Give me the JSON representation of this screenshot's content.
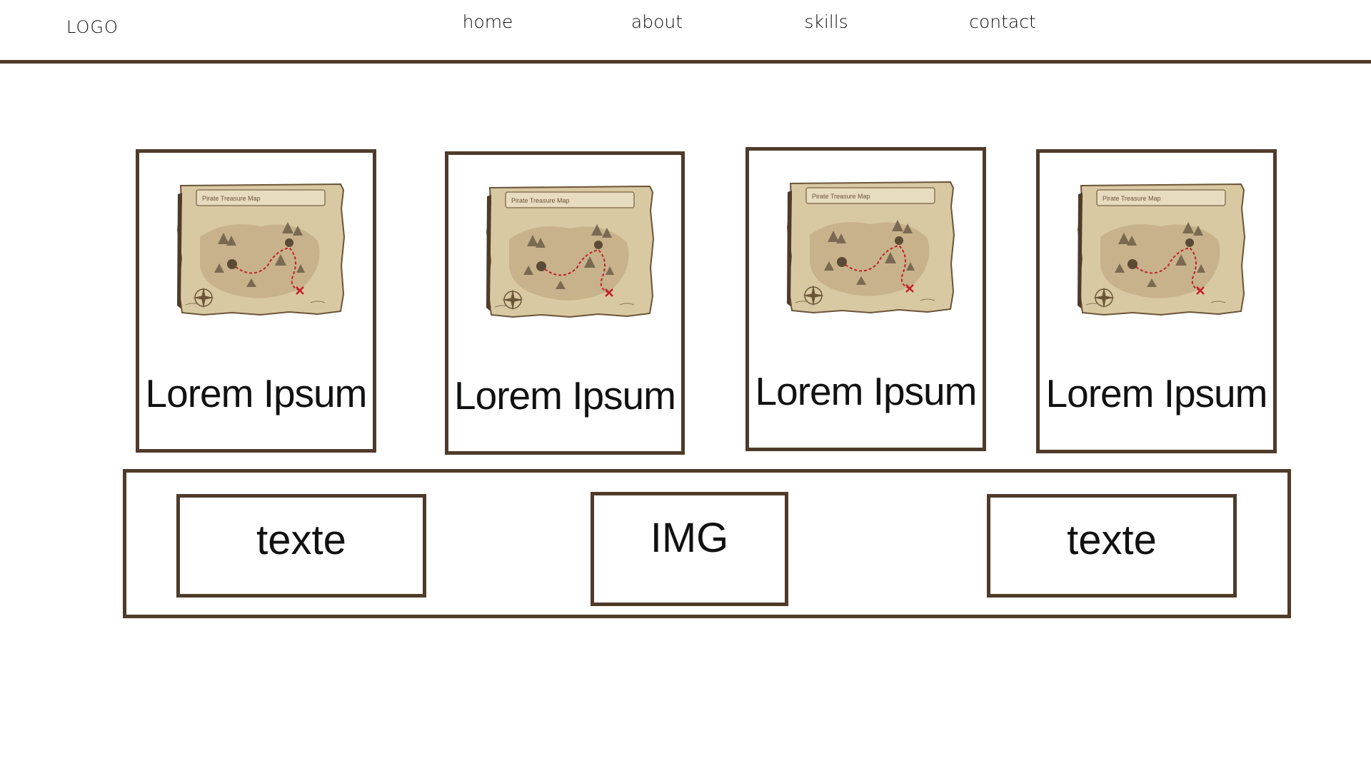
{
  "header": {
    "logo": "LOGO",
    "nav": [
      {
        "label": "home"
      },
      {
        "label": "about"
      },
      {
        "label": "skills"
      },
      {
        "label": "contact"
      }
    ]
  },
  "cards": [
    {
      "title": "Lorem Ipsum",
      "map_label": "Pirate Treasure Map"
    },
    {
      "title": "Lorem Ipsum",
      "map_label": "Pirate Treasure Map"
    },
    {
      "title": "Lorem Ipsum",
      "map_label": "Pirate Treasure Map"
    },
    {
      "title": "Lorem Ipsum",
      "map_label": "Pirate Treasure Map"
    }
  ],
  "footer": {
    "left": "texte",
    "center": "IMG",
    "right": "texte"
  },
  "colors": {
    "border": "#4f3b2a",
    "parchment": "#d9c9a3",
    "parchment_dark": "#c2ad84",
    "route": "#c0202a"
  }
}
